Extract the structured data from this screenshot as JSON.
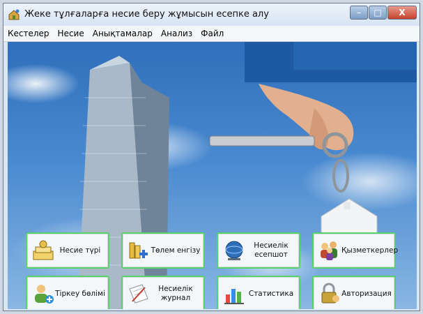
{
  "window": {
    "title": "Жеке тұлғаларға несие беру жұмысын есепке алу",
    "controls": {
      "minimize": "–",
      "maximize": "□",
      "close": "X"
    }
  },
  "menu": [
    "Кестелер",
    "Несие",
    "Анықтамалар",
    "Анализ",
    "Файл"
  ],
  "buttons": {
    "credit_type": "Несие түрі",
    "payment_entry": "Төлем енгізу",
    "credit_report": "Несиелік\nесепшот",
    "employees": "Қызметкерлер",
    "registration": "Тіркеу бөлімі",
    "credit_journal": "Несиелік\nжурнал",
    "statistics": "Статистика",
    "authorization": "Авторизация"
  },
  "icons": {
    "app": "house-key-icon",
    "credit_type": "money-stack-icon",
    "payment_entry": "coins-plus-icon",
    "credit_report": "globe-icon",
    "employees": "people-group-icon",
    "registration": "user-add-icon",
    "credit_journal": "journal-pen-icon",
    "statistics": "bar-chart-icon",
    "authorization": "padlock-user-icon"
  },
  "colors": {
    "button_border": "#59d16a",
    "sky": "#4a8ad0"
  }
}
